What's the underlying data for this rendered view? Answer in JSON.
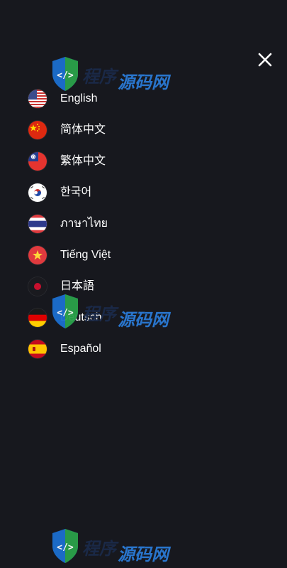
{
  "menu": {
    "close_label": "×",
    "languages": [
      {
        "label": "English",
        "flag": "us-flag-icon"
      },
      {
        "label": "简体中文",
        "flag": "cn-flag-icon"
      },
      {
        "label": "繁体中文",
        "flag": "tw-flag-icon"
      },
      {
        "label": "한국어",
        "flag": "kr-flag-icon"
      },
      {
        "label": "ภาษาไทย",
        "flag": "th-flag-icon"
      },
      {
        "label": "Tiếng Việt",
        "flag": "vn-flag-icon"
      },
      {
        "label": "日本語",
        "flag": "jp-flag-icon"
      },
      {
        "label": "Deutsch",
        "flag": "de-flag-icon"
      },
      {
        "label": "Español",
        "flag": "es-flag-icon"
      }
    ]
  },
  "watermark": {
    "text_part1": "程序",
    "text_part2": "源码网"
  },
  "colors": {
    "background": "#17181e",
    "text": "#ffffff",
    "watermark_dark": "#1b2a4a",
    "watermark_blue": "#2a7ad6"
  }
}
